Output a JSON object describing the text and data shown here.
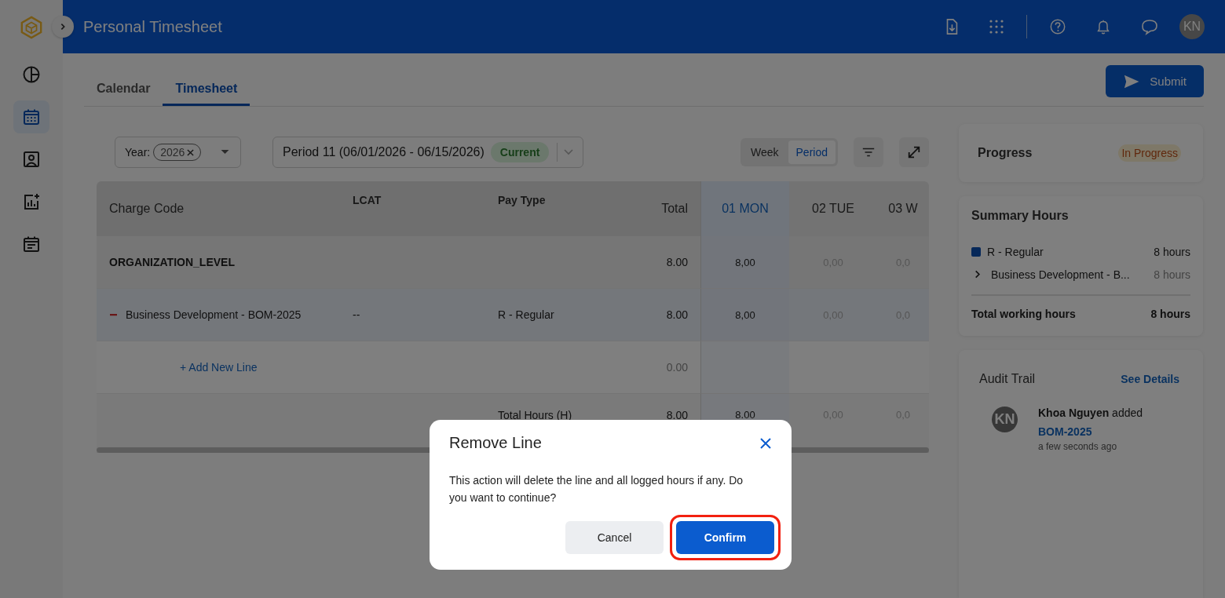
{
  "header": {
    "title": "Personal Timesheet",
    "avatar": "KN"
  },
  "sidebar": {
    "items": [
      {
        "kind": "pie",
        "selected": false
      },
      {
        "kind": "calendar",
        "selected": true
      },
      {
        "kind": "contact",
        "selected": false
      },
      {
        "kind": "chart",
        "selected": false
      },
      {
        "kind": "notes",
        "selected": false
      }
    ]
  },
  "tabs": [
    {
      "label": "Calendar",
      "selected": false
    },
    {
      "label": "Timesheet",
      "selected": true
    }
  ],
  "submit_button": "Submit",
  "filters": {
    "year_label": "Year:",
    "year_chip": "2026",
    "period": "Period 11 (06/01/2026 - 06/15/2026)",
    "period_badge": "Current"
  },
  "view_toggle": [
    {
      "label": "Week",
      "selected": false
    },
    {
      "label": "Period",
      "selected": true
    }
  ],
  "table": {
    "columns": [
      {
        "label": "Charge Code",
        "kind": "main"
      },
      {
        "label": "LCAT",
        "kind": "small"
      },
      {
        "label": "Pay Type",
        "kind": "small"
      },
      {
        "label": "Total",
        "kind": "total"
      },
      {
        "label": "01 MON",
        "kind": "day",
        "selected": true
      },
      {
        "label": "02 TUE",
        "kind": "day",
        "selected": false
      },
      {
        "label": "03 W",
        "kind": "day",
        "selected": false
      }
    ],
    "rows": [
      {
        "kind": "group",
        "cells": [
          "ORGANIZATION_LEVEL",
          "",
          "",
          "8.00",
          "8,00",
          "0,00",
          "0,0"
        ]
      },
      {
        "kind": "line",
        "cells": [
          "Business Development - BOM-2025",
          "--",
          "R - Regular",
          "8.00",
          "8,00",
          "0,00",
          "0,0"
        ]
      },
      {
        "kind": "add",
        "cells": [
          "+ Add New Line",
          "",
          "",
          "0.00",
          "",
          "",
          ""
        ]
      },
      {
        "kind": "total",
        "cells": [
          "",
          "",
          "Total Hours (H)",
          "8.00",
          "8.00",
          "0,00",
          "0,0"
        ]
      }
    ]
  },
  "progress": {
    "title": "Progress",
    "status": "In Progress"
  },
  "summary": {
    "title": "Summary Hours",
    "items": [
      {
        "label": "R - Regular",
        "hours": "8 hours",
        "color": "#062859"
      }
    ],
    "sub_items": [
      {
        "label": "Business Development - B...",
        "hours": "8 hours",
        "expanded": false
      }
    ],
    "total_label": "Total working hours",
    "total_hours": "8 hours"
  },
  "audit_trail": {
    "title": "Audit Trail",
    "link": "See Details",
    "entries": [
      {
        "avatar": "KN",
        "name": "Khoa Nguyen",
        "action": "added",
        "target": "BOM-2025",
        "time": "a few seconds ago"
      }
    ]
  },
  "dialog": {
    "title": "Remove Line",
    "message": "This action will delete the line and all logged hours if any. Do you want to continue?",
    "buttons": [
      {
        "label": "Cancel",
        "kind": "secondary",
        "highlighted": false
      },
      {
        "label": "Confirm",
        "kind": "primary",
        "highlighted": true
      }
    ]
  }
}
